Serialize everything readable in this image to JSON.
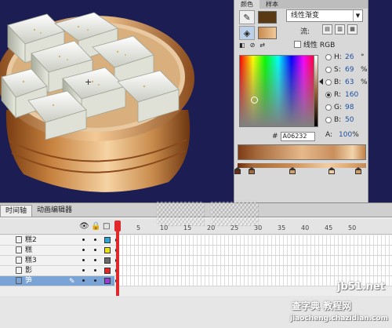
{
  "color_panel": {
    "tabs": [
      "颜色",
      "样本"
    ],
    "fill_type": "线性渐变",
    "flow_label": "流:",
    "linear_rgb_label": "线性 RGB",
    "colors": {
      "stroke": "#5a3a12",
      "fill": "#e2a56a",
      "accent": "#1d4fa0"
    },
    "hsb": [
      {
        "label": "H:",
        "value": "26",
        "unit": "°"
      },
      {
        "label": "S:",
        "value": "69",
        "unit": "%"
      },
      {
        "label": "B:",
        "value": "63",
        "unit": "%"
      }
    ],
    "rgb": [
      {
        "label": "R:",
        "value": "160",
        "unit": ""
      },
      {
        "label": "G:",
        "value": "98",
        "unit": ""
      },
      {
        "label": "B:",
        "value": "50",
        "unit": ""
      }
    ],
    "hex_label": "#",
    "hex": "A06232",
    "alpha_label": "A:",
    "alpha": "100",
    "alpha_unit": "%"
  },
  "timeline": {
    "tabs": [
      "时间轴",
      "动画编辑器"
    ],
    "frame_numbers": [
      "5",
      "10",
      "15",
      "20",
      "25",
      "30",
      "35",
      "40",
      "45",
      "50"
    ],
    "layers": [
      {
        "name": "糕2",
        "color": "#2aa6d8",
        "selected": false
      },
      {
        "name": "糕",
        "color": "#e9e11c",
        "selected": false
      },
      {
        "name": "糕3",
        "color": "#6a6a6a",
        "selected": false
      },
      {
        "name": "影",
        "color": "#e02a2a",
        "selected": false
      },
      {
        "name": "笋",
        "color": "#9a3bd1",
        "selected": true
      }
    ]
  },
  "watermark": {
    "site": "jb51.net",
    "line1": "查字典 教程网",
    "line2": "jiaocheng.chazidian.com"
  }
}
